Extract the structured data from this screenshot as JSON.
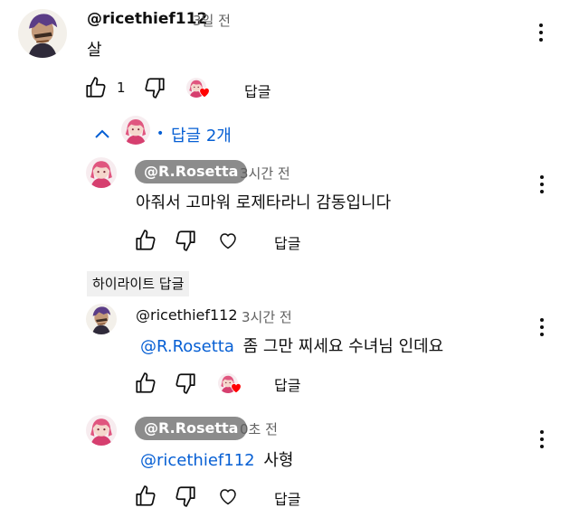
{
  "comment": {
    "author": "@ricethief112",
    "time": "3일 전",
    "text": "살",
    "like_count": "1",
    "reply_label": "답글"
  },
  "replies_toggle": {
    "label": "답글 2개"
  },
  "replies": [
    {
      "author": "@R.Rosetta",
      "time": "3시간 전",
      "text": "아줘서 고마워 로제타라니 감동입니다",
      "reply_label": "답글"
    },
    {
      "highlight_label": "하이라이트 답글",
      "author": "@ricethief112",
      "time": "3시간 전",
      "mention": "@R.Rosetta",
      "text": "좀 그만 찌세요 수녀님 인데요",
      "reply_label": "답글"
    },
    {
      "author": "@R.Rosetta",
      "time": "0초 전",
      "mention": "@ricethief112",
      "text": "사형",
      "reply_label": "답글"
    }
  ],
  "colors": {
    "link_blue": "#065fd4",
    "chip_gray": "#8c8c8c",
    "heart_red": "#ff0000"
  },
  "icons": [
    "thumbs-up-icon",
    "thumbs-down-icon",
    "heart-icon",
    "more-vert-icon",
    "chevron-up-icon"
  ]
}
